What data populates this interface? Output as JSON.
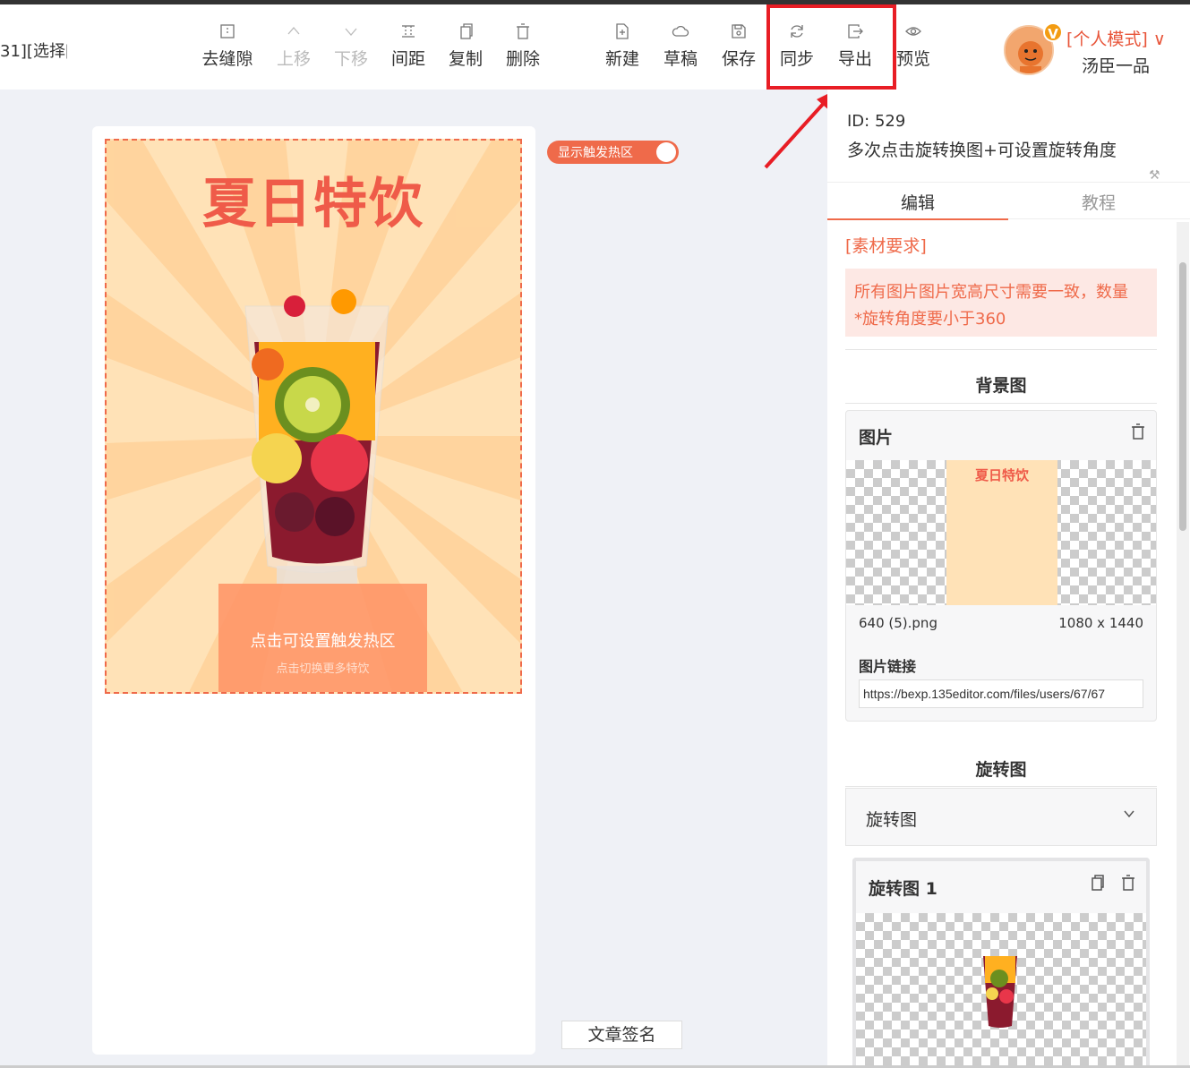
{
  "document": {
    "title": "31][选择["
  },
  "toolbar": {
    "tools_left": [
      {
        "name": "remove-gap",
        "label": "去缝隙",
        "icon": "gap-icon",
        "disabled": false
      },
      {
        "name": "move-up",
        "label": "上移",
        "icon": "arrow-up-icon",
        "disabled": true
      },
      {
        "name": "move-down",
        "label": "下移",
        "icon": "arrow-down-icon",
        "disabled": true
      },
      {
        "name": "spacing",
        "label": "间距",
        "icon": "spacing-icon",
        "disabled": false
      },
      {
        "name": "copy",
        "label": "复制",
        "icon": "copy-icon",
        "disabled": false
      },
      {
        "name": "delete",
        "label": "删除",
        "icon": "trash-icon",
        "disabled": false
      }
    ],
    "tools_right": [
      {
        "name": "new",
        "label": "新建",
        "icon": "new-file-icon"
      },
      {
        "name": "draft",
        "label": "草稿",
        "icon": "cloud-icon"
      },
      {
        "name": "save",
        "label": "保存",
        "icon": "save-icon"
      },
      {
        "name": "sync",
        "label": "同步",
        "icon": "sync-icon"
      },
      {
        "name": "export",
        "label": "导出",
        "icon": "export-icon"
      },
      {
        "name": "preview",
        "label": "预览",
        "icon": "eye-icon"
      }
    ]
  },
  "user": {
    "mode": "[个人模式]",
    "name": "汤臣一品",
    "badge": "V"
  },
  "canvas": {
    "poster_title": "夏日特饮",
    "hotspot_text": "点击可设置触发热区",
    "hotspot_subtext": "点击切换更多特饮",
    "toggle_label": "显示触发热区",
    "sign_button": "文章签名"
  },
  "panel": {
    "id_text": "ID: 529",
    "template_name": "多次点击旋转换图+可设置旋转角度",
    "tabs": [
      "编辑",
      "教程"
    ],
    "requirements_label": "[素材要求]",
    "requirements_line1": "所有图片图片宽高尺寸需要一致，数量",
    "requirements_line2": "*旋转角度要小于360",
    "bg_section": "背景图",
    "bg_card": {
      "header": "图片",
      "thumb_title": "夏日特饮",
      "filename": "640 (5).png",
      "dimensions": "1080 x 1440",
      "link_label": "图片链接",
      "link_value": "https://bexp.135editor.com/files/users/67/67"
    },
    "rotate_section": "旋转图",
    "rotate_dropdown": "旋转图",
    "rotate_item_label": "旋转图 1"
  },
  "colors": {
    "accent": "#ef6a4a",
    "highlight": "#e81d25"
  }
}
